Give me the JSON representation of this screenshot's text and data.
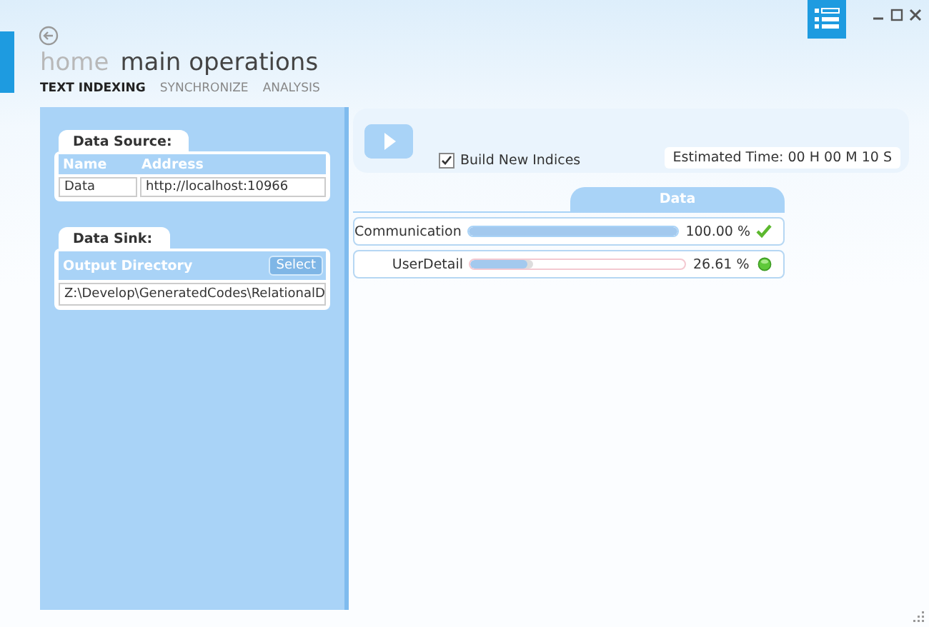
{
  "header": {
    "breadcrumb_home": "home",
    "title": "main operations"
  },
  "tabs": [
    {
      "label": "TEXT INDEXING",
      "selected": true
    },
    {
      "label": "SYNCHRONIZE",
      "selected": false
    },
    {
      "label": "ANALYSIS",
      "selected": false
    }
  ],
  "data_source": {
    "title": "Data Source:",
    "columns": [
      "Name",
      "Address"
    ],
    "row": [
      "Data",
      "http://localhost:10966"
    ]
  },
  "data_sink": {
    "title": "Data Sink:",
    "column": "Output Directory",
    "button": "Select",
    "value": "Z:\\Develop\\GeneratedCodes\\RelationalD"
  },
  "toolbar": {
    "build_new_indices": {
      "label": "Build New Indices",
      "checked": true
    },
    "estimated_time": "Estimated Time: 00 H 00 M 10 S"
  },
  "progress": {
    "tab": "Data",
    "rows": [
      {
        "name": "Communication",
        "level": 1.0,
        "reading": "100.00 %",
        "kind": "done"
      },
      {
        "name": "UserDetail",
        "level": 0.2661,
        "reading": "26.61 %",
        "kind": "running"
      }
    ]
  }
}
